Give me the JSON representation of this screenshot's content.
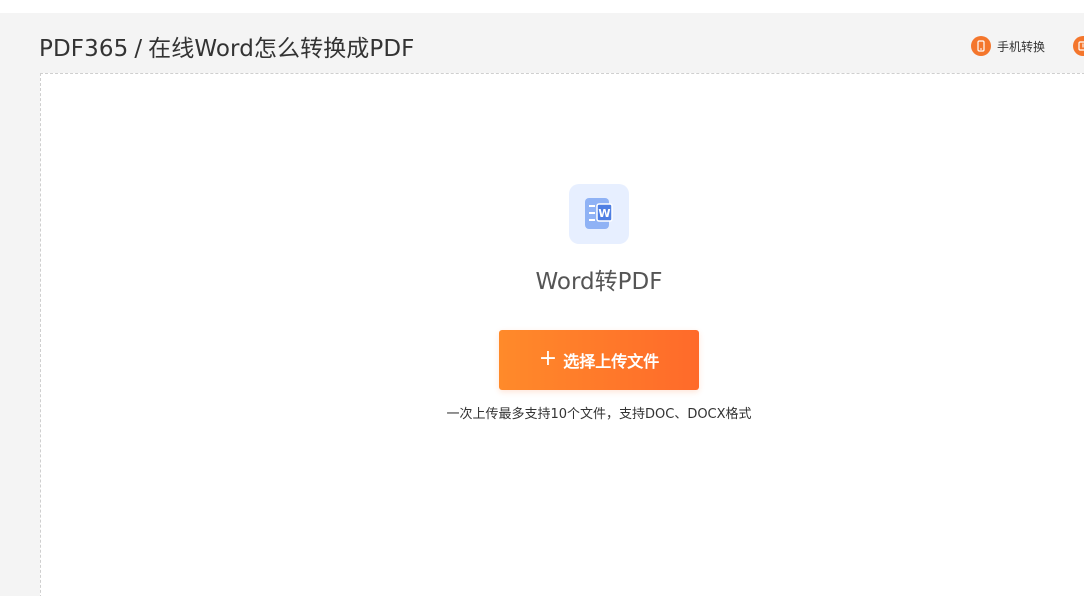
{
  "header": {
    "brand": "PDF365",
    "separator": "/",
    "page_title": "在线Word怎么转换成PDF",
    "mobile_convert_label": "手机转换"
  },
  "tool": {
    "icon": "word-document-icon",
    "icon_letter": "W",
    "name": "Word转PDF",
    "upload_button_label": "选择上传文件",
    "upload_hint": "一次上传最多支持10个文件，支持DOC、DOCX格式"
  },
  "colors": {
    "accent": "#f4762c",
    "button_gradient_start": "#ff8a2a",
    "button_gradient_end": "#ff6a2a",
    "tool_icon_bg": "#e7efff",
    "tool_icon_blue": "#6c9cf2"
  }
}
